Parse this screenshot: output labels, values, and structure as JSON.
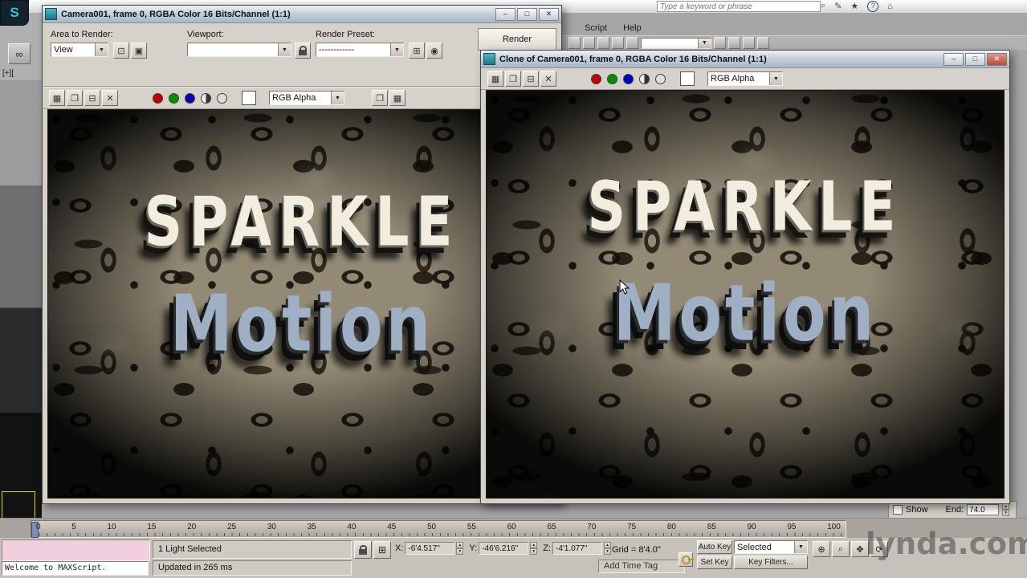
{
  "infocenter": {
    "search_placeholder": "Type a keyword or phrase"
  },
  "menu": {
    "items": [
      "Script",
      "Help"
    ]
  },
  "left_window": {
    "title": "Camera001, frame 0, RGBA Color 16 Bits/Channel (1:1)",
    "area_to_render_label": "Area to Render:",
    "area_to_render_value": "View",
    "viewport_label": "Viewport:",
    "viewport_value": "",
    "render_preset_label": "Render Preset:",
    "render_preset_value": "------------",
    "render_button": "Render",
    "channel_value": "RGB Alpha"
  },
  "right_window": {
    "title": "Clone of Camera001, frame 0, RGBA Color 16 Bits/Channel (1:1)",
    "channel_value": "RGB Alpha"
  },
  "render_image": {
    "line1": "SPARKLE",
    "line2": "Motion"
  },
  "left_strip": {
    "viewport_label": "[+]["
  },
  "timeline": {
    "ticks": [
      "0",
      "5",
      "10",
      "15",
      "20",
      "25",
      "30",
      "35",
      "40",
      "45",
      "50",
      "55",
      "60",
      "65",
      "70",
      "75",
      "80",
      "85",
      "90",
      "95",
      "100"
    ]
  },
  "status": {
    "listener_text": "Welcome to MAXScript.",
    "prompt": "1 Light Selected",
    "updated": "Updated in 265 ms",
    "x_label": "X:",
    "x_value": "-6'4.517\"",
    "y_label": "Y:",
    "y_value": "-46'6.216\"",
    "z_label": "Z:",
    "z_value": "-4'1.077\"",
    "grid": "Grid = 8'4.0\"",
    "add_time_tag": "Add Time Tag",
    "auto_key": "Auto Key",
    "selected_set": "Selected",
    "set_key": "Set Key",
    "key_filters": "Key Filters..."
  },
  "show_end": {
    "show_label": "Show",
    "end_label": "End:",
    "end_value": "74.0"
  },
  "watermark": "lynda.com",
  "icons": {
    "minimize": "–",
    "maximize": "□",
    "close": "✕",
    "dropdown": "▼",
    "spin_up": "▲",
    "spin_down": "▼",
    "search": "⌕",
    "pen": "✎",
    "star": "★",
    "help": "?",
    "home": "⌂",
    "save": "▦",
    "clone": "❐",
    "print": "⊟",
    "delete": "✕",
    "region": "⊡",
    "crop": "▣",
    "setup": "⊞",
    "environment": "◉",
    "link": "∞",
    "zoom_in": "⊕",
    "magnify": "⌕",
    "pan": "✥",
    "orbit": "⟳",
    "logo": "S"
  }
}
